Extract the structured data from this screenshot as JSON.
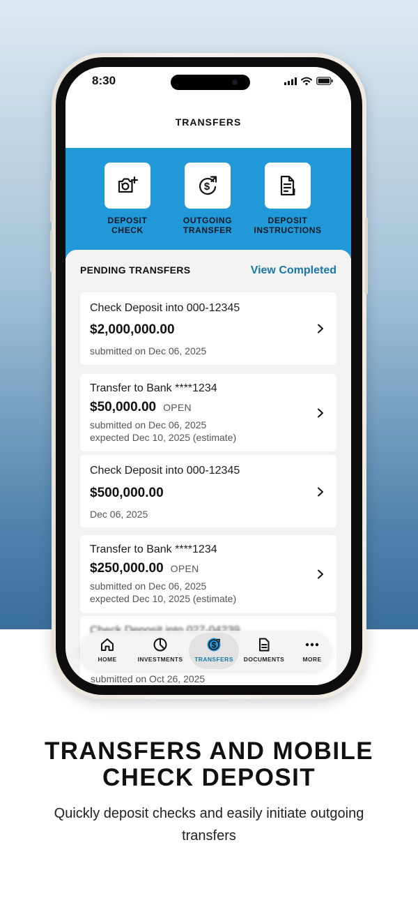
{
  "status_bar": {
    "time": "8:30"
  },
  "header": {
    "title": "TRANSFERS"
  },
  "actions": [
    {
      "label": "DEPOSIT\nCHECK",
      "icon": "camera-plus-icon"
    },
    {
      "label": "OUTGOING\nTRANSFER",
      "icon": "dollar-transfer-icon"
    },
    {
      "label": "DEPOSIT\nINSTRUCTIONS",
      "icon": "document-list-icon"
    }
  ],
  "pending": {
    "title": "PENDING TRANSFERS",
    "view_completed": "View Completed",
    "cards": [
      {
        "title": "Check Deposit into 000-12345",
        "amount": "$2,000,000.00",
        "status": "",
        "line1": "submitted on Dec 06, 2025",
        "line2": ""
      },
      {
        "title": "Transfer to Bank ****1234",
        "amount": "$50,000.00",
        "status": "OPEN",
        "line1": "submitted on Dec 06, 2025",
        "line2": "expected Dec 10, 2025 (estimate)"
      },
      {
        "title": "Check Deposit into 000-12345",
        "amount": "$500,000.00",
        "status": "",
        "line1": "Dec 06, 2025",
        "line2": ""
      },
      {
        "title": "Transfer to Bank ****1234",
        "amount": "$250,000.00",
        "status": "OPEN",
        "line1": "submitted on Dec 06, 2025",
        "line2": "expected Dec 10, 2025 (estimate)"
      }
    ],
    "partial_card": {
      "title": "Check Deposit into 027-04239",
      "line1": "submitted on Oct 26, 2025"
    }
  },
  "tabs": [
    {
      "label": "HOME",
      "icon": "home-icon"
    },
    {
      "label": "INVESTMENTS",
      "icon": "pie-chart-icon"
    },
    {
      "label": "TRANSFERS",
      "icon": "transfer-dollar-icon",
      "active": true
    },
    {
      "label": "DOCUMENTS",
      "icon": "document-icon"
    },
    {
      "label": "MORE",
      "icon": "more-icon"
    }
  ],
  "marketing": {
    "headline": "TRANSFERS AND MOBILE CHECK DEPOSIT",
    "subline": "Quickly deposit checks and easily initiate outgoing transfers"
  },
  "colors": {
    "accent": "#2199d9",
    "link": "#1877a8",
    "gradient_bottom": "#3a6e9a"
  }
}
